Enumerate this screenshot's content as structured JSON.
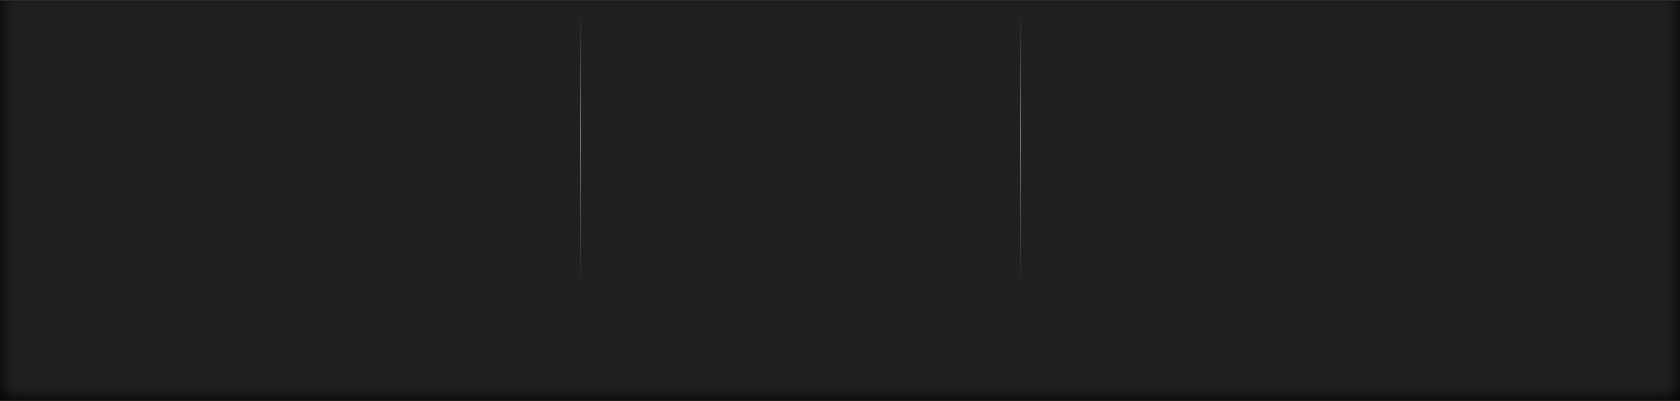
{
  "panel": {
    "background_color": "#202020",
    "divider_color": "#878787",
    "column_count": 3
  }
}
